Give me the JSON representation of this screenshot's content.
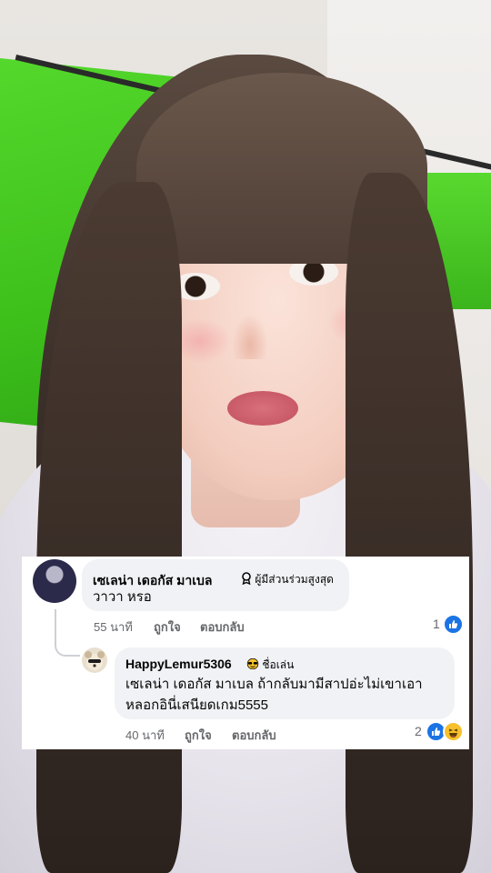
{
  "comments": [
    {
      "author": "เซเลน่า เดอกัส มาเบล",
      "badge": "ผู้มีส่วนร่วมสูงสุด",
      "text": "วาวา หรอ",
      "time": "55 นาที",
      "like_label": "ถูกใจ",
      "reply_label": "ตอบกลับ",
      "reaction_count": "1",
      "reactions": [
        "like"
      ]
    },
    {
      "author": "HappyLemur5306",
      "badge": "ชื่อเล่น",
      "text_line1": "เซเลน่า เดอกัส มาเบล ถ้ากลับมามีสาปอ่ะไม่เขาเอา",
      "text_line2": "หลอกอินี่เสนียดเกม5555",
      "time": "40 นาที",
      "like_label": "ถูกใจ",
      "reply_label": "ตอบกลับ",
      "reaction_count": "2",
      "reactions": [
        "like",
        "haha"
      ]
    }
  ],
  "colors": {
    "greenscreen": "#3ec01b",
    "like_blue": "#1b74e4",
    "bubble_bg": "#f0f2f5",
    "meta_gray": "#65676b"
  }
}
